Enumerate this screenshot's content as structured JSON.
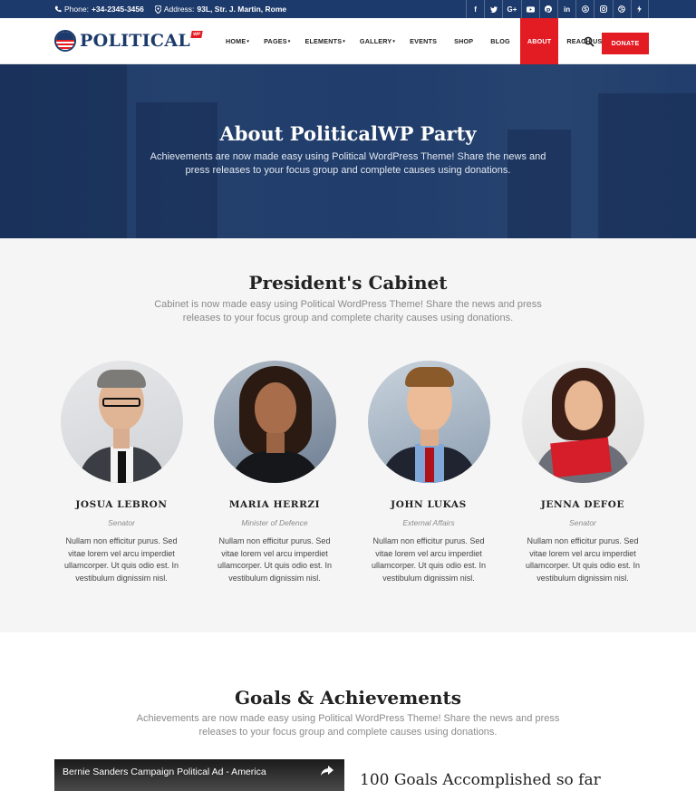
{
  "topbar": {
    "phone_label": "Phone:",
    "phone": "+34-2345-3456",
    "address_label": "Address:",
    "address": "93L, Str. J. Martin, Rome",
    "socials": [
      "f",
      "t",
      "G+",
      "yt",
      "p",
      "in",
      "sk",
      "ig",
      "dr",
      "fs"
    ]
  },
  "header": {
    "logo": "POLITICAL",
    "logo_tag": "WP",
    "nav": [
      {
        "label": "Home",
        "caret": "▾"
      },
      {
        "label": "Pages",
        "caret": "▾"
      },
      {
        "label": "Elements",
        "caret": "▾"
      },
      {
        "label": "Gallery",
        "caret": "▾"
      },
      {
        "label": "Events",
        "caret": ""
      },
      {
        "label": "Shop",
        "caret": ""
      },
      {
        "label": "Blog",
        "caret": ""
      },
      {
        "label": "About",
        "caret": ""
      },
      {
        "label": "Reach Us",
        "caret": ""
      }
    ],
    "donate": "Donate"
  },
  "hero": {
    "title": "About PoliticalWP Party",
    "text": "Achievements are now made easy using Political WordPress Theme! Share the news and press releases to your focus group and complete causes using donations."
  },
  "cabinet": {
    "title": "President's Cabinet",
    "subtitle": "Cabinet is now made easy using Political WordPress Theme! Share the news and press releases to your focus group and complete charity causes using donations.",
    "members": [
      {
        "name": "Josua Lebron",
        "role": "Senator",
        "bio": "Nullam non efficitur purus. Sed vitae lorem vel arcu imperdiet ullamcorper. Ut quis odio est. In vestibulum dignissim nisl."
      },
      {
        "name": "Maria Herrzi",
        "role": "Minister of Defence",
        "bio": "Nullam non efficitur purus. Sed vitae lorem vel arcu imperdiet ullamcorper. Ut quis odio est. In vestibulum dignissim nisl."
      },
      {
        "name": "John Lukas",
        "role": "External Affairs",
        "bio": "Nullam non efficitur purus. Sed vitae lorem vel arcu imperdiet ullamcorper. Ut quis odio est. In vestibulum dignissim nisl."
      },
      {
        "name": "Jenna Defoe",
        "role": "Senator",
        "bio": "Nullam non efficitur purus. Sed vitae lorem vel arcu imperdiet ullamcorper. Ut quis odio est. In vestibulum dignissim nisl."
      }
    ]
  },
  "goals": {
    "title": "Goals & Achievements",
    "subtitle": "Achievements are now made easy using Political WordPress Theme! Share the news and press releases to your focus group and complete causes using donations.",
    "video_title": "Bernie Sanders Campaign Political Ad - America",
    "count_heading": "100 Goals Accomplished so far"
  },
  "colors": {
    "navy": "#1c3a6b",
    "red": "#e31b23"
  }
}
